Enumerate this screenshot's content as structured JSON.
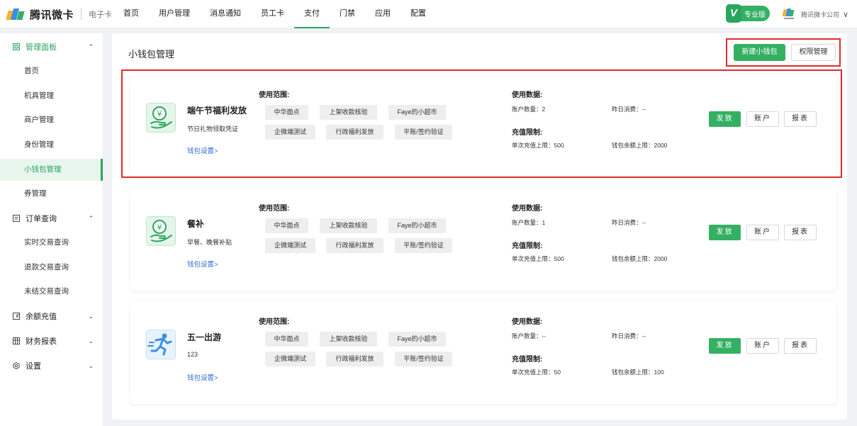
{
  "colors": {
    "accent": "#34b063",
    "highlight": "#e02b2b",
    "link": "#2f6bd8"
  },
  "header": {
    "brand": "腾讯微卡",
    "sub_brand": "电子卡",
    "nav": [
      "首页",
      "用户管理",
      "消息通知",
      "员工卡",
      "支付",
      "门禁",
      "应用",
      "配置"
    ],
    "active_nav": "支付",
    "pro_badge": "专业版",
    "pro_badge_icon": "V",
    "company": "腾讯微卡公司",
    "company_icon": "company-logo-icon",
    "dropdown_icon": "chevron-down-icon"
  },
  "sidebar": {
    "groups": [
      {
        "label": "管理面板",
        "icon": "grid-icon",
        "expanded": true
      },
      {
        "label": "订单查询",
        "icon": "document-icon",
        "expanded": true
      },
      {
        "label": "余额充值",
        "icon": "wallet-icon",
        "expanded": false
      },
      {
        "label": "财务报表",
        "icon": "table-icon",
        "expanded": false
      },
      {
        "label": "设置",
        "icon": "gear-icon",
        "expanded": false
      }
    ],
    "panel_items": [
      "首页",
      "机具管理",
      "商户管理",
      "身份管理",
      "小钱包管理",
      "券管理"
    ],
    "order_items": [
      "实时交易查询",
      "退款交易查询",
      "未结交易查询"
    ],
    "active_item": "小钱包管理"
  },
  "page": {
    "title": "小钱包管理",
    "new_wallet_button": "新建小钱包",
    "permissions_button": "权限管理"
  },
  "labels": {
    "scope": "使用范围:",
    "usage": "使用数据:",
    "limits": "充值限制:",
    "wallet_settings": "钱包设置>",
    "issue": "发放",
    "account": "账户",
    "report": "报表"
  },
  "wallets": [
    {
      "name": "端午节福利发放",
      "desc": "节日礼物领取凭证",
      "icon": "money-hand-icon",
      "tags": [
        "中华面点",
        "上架收款核验",
        "Faye的小超市",
        "企微端测试",
        "行政福利发放",
        "平账/签约验证"
      ],
      "account_count": "账户数量：2",
      "yesterday_spend": "昨日消费：--",
      "single_limit": "单次充值上限：500",
      "balance_limit": "钱包余额上限：2000"
    },
    {
      "name": "餐补",
      "desc": "早餐、晚餐补贴",
      "icon": "money-hand-icon",
      "tags": [
        "中华面点",
        "上架收款核验",
        "Faye的小超市",
        "企微端测试",
        "行政福利发放",
        "平账/签约验证"
      ],
      "account_count": "账户数量：1",
      "yesterday_spend": "昨日消费：--",
      "single_limit": "单次充值上限：500",
      "balance_limit": "钱包余额上限：2000"
    },
    {
      "name": "五一出游",
      "desc": "123",
      "icon": "running-man-icon",
      "tags": [
        "中华面点",
        "上架收款核验",
        "Faye的小超市",
        "企微端测试",
        "行政福利发放",
        "平账/签约验证"
      ],
      "account_count": "账户数量：--",
      "yesterday_spend": "昨日消费：--",
      "single_limit": "单次充值上限：50",
      "balance_limit": "钱包余额上限：100"
    }
  ]
}
